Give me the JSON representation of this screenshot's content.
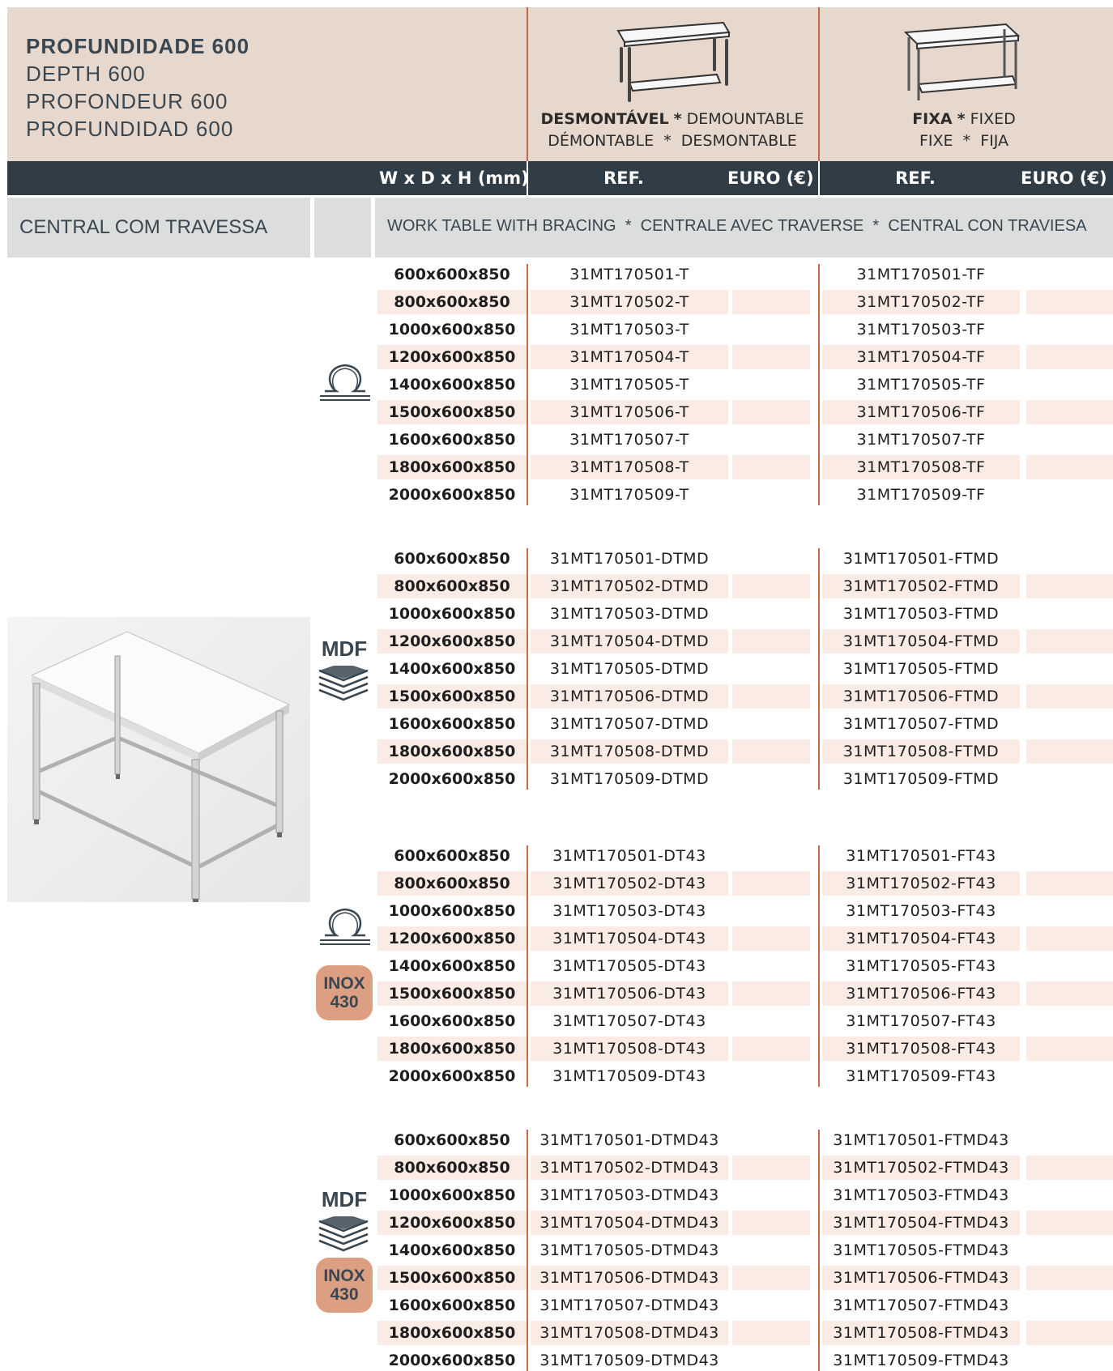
{
  "header": {
    "title_lines": [
      "PROFUNDIDADE 600",
      "DEPTH 600",
      "PROFONDEUR 600",
      "PROFUNDIDAD 600"
    ],
    "demountable": {
      "bold": "DESMONTÁVEL",
      "sep": "*",
      "line1_rest": "DEMOUNTABLE",
      "line2": "DÉMONTABLE  *  DESMONTABLE"
    },
    "fixed": {
      "bold": "FIXA",
      "sep": "*",
      "line1_rest": "FIXED",
      "line2": "FIXE  *  FIJA"
    }
  },
  "columns": {
    "dims": "W x D x H (mm)",
    "ref_demountable": "REF.",
    "euro_demountable": "EURO (€)",
    "ref_fixed": "REF.",
    "euro_fixed": "EURO (€)"
  },
  "category": {
    "name": "CENTRAL COM TRAVESSA",
    "translations": "WORK TABLE WITH BRACING  *  CENTRALE AVEC TRAVERSE  *  CENTRAL CON TRAVIESA"
  },
  "sizes": [
    "600x600x850",
    "800x600x850",
    "1000x600x850",
    "1200x600x850",
    "1400x600x850",
    "1500x600x850",
    "1600x600x850",
    "1800x600x850",
    "2000x600x850"
  ],
  "icons": {
    "mdf_label": "MDF",
    "inox_line1": "INOX",
    "inox_line2": "430",
    "accent": "#dd9f82",
    "dark": "#303c46"
  },
  "groups": [
    {
      "icons": [
        "omega-icon"
      ],
      "demountable": [
        "31MT170501-T",
        "31MT170502-T",
        "31MT170503-T",
        "31MT170504-T",
        "31MT170505-T",
        "31MT170506-T",
        "31MT170507-T",
        "31MT170508-T",
        "31MT170509-T"
      ],
      "fixed": [
        "31MT170501-TF",
        "31MT170502-TF",
        "31MT170503-TF",
        "31MT170504-TF",
        "31MT170505-TF",
        "31MT170506-TF",
        "31MT170507-TF",
        "31MT170508-TF",
        "31MT170509-TF"
      ]
    },
    {
      "icons": [
        "mdf-icon"
      ],
      "demountable": [
        "31MT170501-DTMD",
        "31MT170502-DTMD",
        "31MT170503-DTMD",
        "31MT170504-DTMD",
        "31MT170505-DTMD",
        "31MT170506-DTMD",
        "31MT170507-DTMD",
        "31MT170508-DTMD",
        "31MT170509-DTMD"
      ],
      "fixed": [
        "31MT170501-FTMD",
        "31MT170502-FTMD",
        "31MT170503-FTMD",
        "31MT170504-FTMD",
        "31MT170505-FTMD",
        "31MT170506-FTMD",
        "31MT170507-FTMD",
        "31MT170508-FTMD",
        "31MT170509-FTMD"
      ]
    },
    {
      "icons": [
        "omega-icon",
        "inox-430-badge"
      ],
      "demountable": [
        "31MT170501-DT43",
        "31MT170502-DT43",
        "31MT170503-DT43",
        "31MT170504-DT43",
        "31MT170505-DT43",
        "31MT170506-DT43",
        "31MT170507-DT43",
        "31MT170508-DT43",
        "31MT170509-DT43"
      ],
      "fixed": [
        "31MT170501-FT43",
        "31MT170502-FT43",
        "31MT170503-FT43",
        "31MT170504-FT43",
        "31MT170505-FT43",
        "31MT170506-FT43",
        "31MT170507-FT43",
        "31MT170508-FT43",
        "31MT170509-FT43"
      ]
    },
    {
      "icons": [
        "mdf-icon",
        "inox-430-badge"
      ],
      "demountable": [
        "31MT170501-DTMD43",
        "31MT170502-DTMD43",
        "31MT170503-DTMD43",
        "31MT170504-DTMD43",
        "31MT170505-DTMD43",
        "31MT170506-DTMD43",
        "31MT170507-DTMD43",
        "31MT170508-DTMD43",
        "31MT170509-DTMD43"
      ],
      "fixed": [
        "31MT170501-FTMD43",
        "31MT170502-FTMD43",
        "31MT170503-FTMD43",
        "31MT170504-FTMD43",
        "31MT170505-FTMD43",
        "31MT170506-FTMD43",
        "31MT170507-FTMD43",
        "31MT170508-FTMD43",
        "31MT170509-FTMD43"
      ]
    }
  ]
}
